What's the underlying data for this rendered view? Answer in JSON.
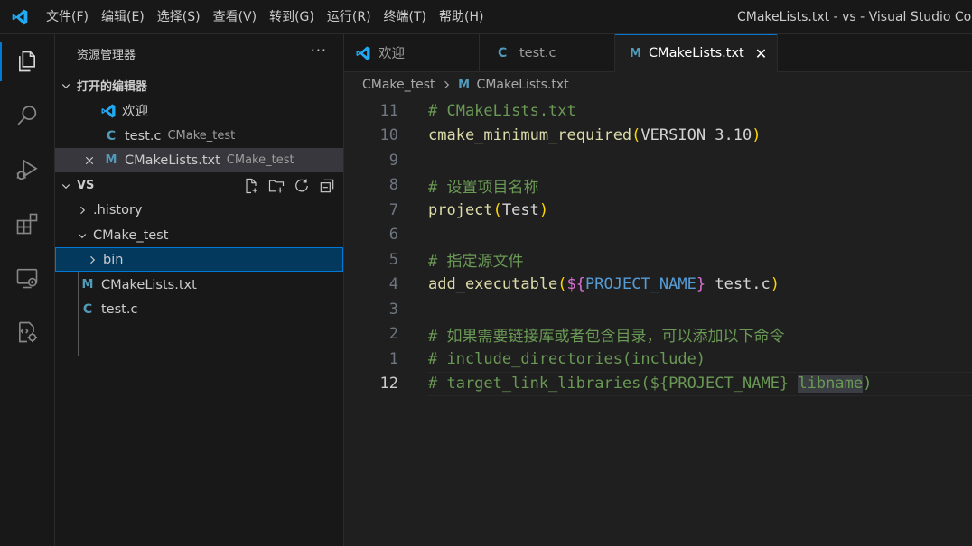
{
  "titlebar": {
    "menu": [
      "文件(F)",
      "编辑(E)",
      "选择(S)",
      "查看(V)",
      "转到(G)",
      "运行(R)",
      "终端(T)",
      "帮助(H)"
    ],
    "window_title": "CMakeLists.txt - vs - Visual Studio Code"
  },
  "activitybar": {
    "icons": [
      "explorer-icon",
      "search-icon",
      "run-debug-icon",
      "extensions-icon",
      "remote-explorer-icon",
      "cmake-icon"
    ]
  },
  "sidebar": {
    "title": "资源管理器",
    "more": "···",
    "open_editors": {
      "label": "打开的编辑器",
      "items": [
        {
          "name": "欢迎",
          "desc": ""
        },
        {
          "name": "test.c",
          "desc": "CMake_test"
        },
        {
          "name": "CMakeLists.txt",
          "desc": "CMake_test"
        }
      ]
    },
    "workspace": {
      "label": "VS",
      "tree": [
        {
          "name": ".history"
        },
        {
          "name": "CMake_test"
        },
        {
          "name": "bin"
        },
        {
          "name": "CMakeLists.txt"
        },
        {
          "name": "test.c"
        }
      ]
    }
  },
  "tabs": [
    {
      "label": "欢迎"
    },
    {
      "label": "test.c"
    },
    {
      "label": "CMakeLists.txt"
    }
  ],
  "breadcrumb": {
    "folder": "CMake_test",
    "file": "CMakeLists.txt"
  },
  "editor": {
    "lines": [
      {
        "num": "11",
        "parts": [
          {
            "t": "# CMakeLists.txt",
            "c": "c-comment"
          }
        ]
      },
      {
        "num": "10",
        "parts": [
          {
            "t": "cmake_minimum_required",
            "c": "c-fn"
          },
          {
            "t": "(",
            "c": "c-paren"
          },
          {
            "t": "VERSION 3.10",
            "c": "c-kw"
          },
          {
            "t": ")",
            "c": "c-paren"
          }
        ]
      },
      {
        "num": "9",
        "parts": []
      },
      {
        "num": "8",
        "parts": [
          {
            "t": "# 设置项目名称",
            "c": "c-comment"
          }
        ]
      },
      {
        "num": "7",
        "parts": [
          {
            "t": "project",
            "c": "c-fn"
          },
          {
            "t": "(",
            "c": "c-paren"
          },
          {
            "t": "Test",
            "c": "c-kw"
          },
          {
            "t": ")",
            "c": "c-paren"
          }
        ]
      },
      {
        "num": "6",
        "parts": []
      },
      {
        "num": "5",
        "parts": [
          {
            "t": "# 指定源文件",
            "c": "c-comment"
          }
        ]
      },
      {
        "num": "4",
        "parts": [
          {
            "t": "add_executable",
            "c": "c-fn"
          },
          {
            "t": "(",
            "c": "c-paren"
          },
          {
            "t": "${",
            "c": "c-var1"
          },
          {
            "t": "PROJECT_NAME",
            "c": "c-var2"
          },
          {
            "t": "}",
            "c": "c-var1"
          },
          {
            "t": " test.c",
            "c": "c-kw"
          },
          {
            "t": ")",
            "c": "c-paren"
          }
        ]
      },
      {
        "num": "3",
        "parts": []
      },
      {
        "num": "2",
        "parts": [
          {
            "t": "# 如果需要链接库或者包含目录，可以添加以下命令",
            "c": "c-comment"
          }
        ]
      },
      {
        "num": "1",
        "parts": [
          {
            "t": "# include_directories(include)",
            "c": "c-comment"
          }
        ]
      },
      {
        "num": "12",
        "parts": [
          {
            "t": "# target_link_libraries(${PROJECT_NAME} ",
            "c": "c-comment"
          },
          {
            "t": "libname",
            "c": "c-comment c-cmt-hl"
          },
          {
            "t": ")",
            "c": "c-comment"
          }
        ]
      }
    ]
  }
}
